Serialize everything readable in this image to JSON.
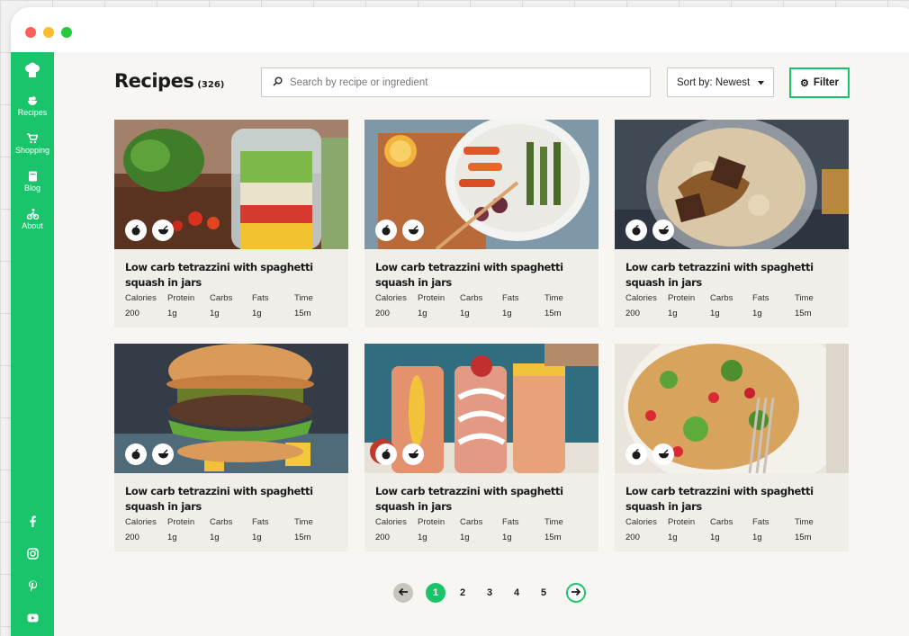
{
  "window": {
    "controls": [
      "close",
      "minimize",
      "zoom"
    ]
  },
  "sidebar": {
    "logo": "chef-hat-icon",
    "items": [
      {
        "label": "Recipes",
        "icon": "salad-icon"
      },
      {
        "label": "Shopping",
        "icon": "cart-icon"
      },
      {
        "label": "Blog",
        "icon": "book-icon"
      },
      {
        "label": "About",
        "icon": "cyclist-icon"
      }
    ],
    "social": [
      "facebook-icon",
      "instagram-icon",
      "pinterest-icon",
      "youtube-icon"
    ]
  },
  "header": {
    "title": "Recipes",
    "count": "(326)",
    "search_placeholder": "Search by recipe or ingredient",
    "sort_label": "Sort by: Newest",
    "filter_label": "Filter"
  },
  "colors": {
    "accent": "#19c46b",
    "window": "#f7f6f2",
    "card": "#f0eee8"
  },
  "stat_labels": [
    "Calories",
    "Protein",
    "Carbs",
    "Fats",
    "Time"
  ],
  "recipes": [
    {
      "title": "Low carb tetrazzini with spaghetti squash in jars",
      "image": "salad-jar",
      "calories": "200",
      "protein": "1g",
      "carbs": "1g",
      "fats": "1g",
      "time": "15m"
    },
    {
      "title": "Low carb tetrazzini with spaghetti squash in jars",
      "image": "roasted-vegetables",
      "calories": "200",
      "protein": "1g",
      "carbs": "1g",
      "fats": "1g",
      "time": "15m"
    },
    {
      "title": "Low carb tetrazzini with spaghetti squash in jars",
      "image": "oatmeal-bowl",
      "calories": "200",
      "protein": "1g",
      "carbs": "1g",
      "fats": "1g",
      "time": "15m"
    },
    {
      "title": "Low carb tetrazzini with spaghetti squash in jars",
      "image": "veggie-burger",
      "calories": "200",
      "protein": "1g",
      "carbs": "1g",
      "fats": "1g",
      "time": "15m"
    },
    {
      "title": "Low carb tetrazzini with spaghetti squash in jars",
      "image": "smoothie-glasses",
      "calories": "200",
      "protein": "1g",
      "carbs": "1g",
      "fats": "1g",
      "time": "15m"
    },
    {
      "title": "Low carb tetrazzini with spaghetti squash in jars",
      "image": "chickpea-salad",
      "calories": "200",
      "protein": "1g",
      "carbs": "1g",
      "fats": "1g",
      "time": "15m"
    }
  ],
  "pagination": {
    "pages": [
      "1",
      "2",
      "3",
      "4",
      "5"
    ],
    "current": "1"
  }
}
